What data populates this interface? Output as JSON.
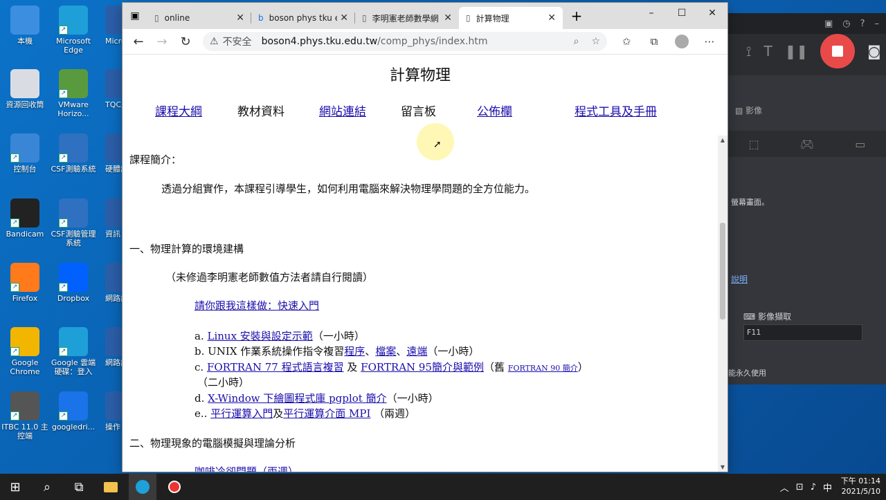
{
  "desktop": {
    "icons": [
      {
        "label": "本機",
        "color": "#3c8fe0"
      },
      {
        "label": "Microsoft Edge",
        "color": "#1e9fd8"
      },
      {
        "label": "資源回收筒",
        "color": "#d9dde3"
      },
      {
        "label": "VMware Horizo...",
        "color": "#5a9a3e"
      },
      {
        "label": "控制台",
        "color": "#3a86d6"
      },
      {
        "label": "CSF測驗系統",
        "color": "#3070c0"
      },
      {
        "label": "Bandicam",
        "color": "#222"
      },
      {
        "label": "CSF測驗管理系統",
        "color": "#3070c0"
      },
      {
        "label": "Firefox",
        "color": "#ff7a1a"
      },
      {
        "label": "Dropbox",
        "color": "#0061fe"
      },
      {
        "label": "Google Chrome",
        "color": "#f2b500"
      },
      {
        "label": "Google 雲端硬碟：登入",
        "color": "#1e9fd8"
      },
      {
        "label": "ITBC 11.0 主控端",
        "color": "#555"
      },
      {
        "label": "googledri...",
        "color": "#1a73e8"
      }
    ],
    "partial_icons": [
      "Micro Tea",
      "TQC題 習系統",
      "硬體說 軟體說",
      "資訊",
      "網路說 統說明",
      "網路說 入說",
      "操作"
    ]
  },
  "bandicam": {
    "menu_items": [
      "影像",
      "螢幕畫面。",
      "說明",
      "影像擷取",
      "F11",
      "能永久使用"
    ]
  },
  "browser": {
    "tabs": [
      {
        "title": "online",
        "icon": "page-icon"
      },
      {
        "title": "boson phys tku edu",
        "icon": "bing-icon"
      },
      {
        "title": "李明憲老師數學網",
        "icon": "page-icon"
      },
      {
        "title": "計算物理",
        "icon": "page-icon"
      }
    ],
    "new_tab": "+",
    "window_controls": [
      "–",
      "☐",
      "✕"
    ],
    "address": {
      "security": "不安全",
      "host": "boson4.phys.tku.edu.tw",
      "path": "/comp_phys/index.htm"
    }
  },
  "page": {
    "title": "計算物理",
    "nav": [
      "課程大綱",
      "教材資料",
      "網站連結",
      "留言板",
      "公佈欄",
      "程式工具及手冊"
    ],
    "intro_heading": "課程簡介：",
    "intro_text": "透過分組實作，本課程引導學生，如何利用電腦來解決物理學問題的全方位能力。",
    "section1": "一、物理計算的環境建構",
    "section1_note": "（未修過李明憲老師數值方法者請自行閱讀）",
    "quickstart": "請你跟我這樣做：快速入門",
    "item_a_prefix": "a.",
    "item_a_link": "Linux 安裝與設定示範",
    "item_a_tail": "（一小時）",
    "item_b_prefix": "b.",
    "item_b_text": "UNIX 作業系統操作指令複習",
    "item_b_l1": "程序",
    "item_b_sep1": "、",
    "item_b_l2": "檔案",
    "item_b_sep2": "、",
    "item_b_l3": "遠端",
    "item_b_tail": "（一小時）",
    "item_c_prefix": "c.",
    "item_c_l1": "FORTRAN 77 程式語言複習",
    "item_c_and": "及",
    "item_c_l2": "FORTRAN 95簡介與範例",
    "item_c_old": "（舊",
    "item_c_l3": "FORTRAN 90 簡介",
    "item_c_close": "）",
    "item_c_time": "（二小時）",
    "item_d_prefix": "d.",
    "item_d_link": "X-Window 下繪圖程式庫 pgplot 簡介",
    "item_d_tail": "（一小時）",
    "item_e_prefix": "e..",
    "item_e_l1": "平行運算入門",
    "item_e_and": "及",
    "item_e_l2": "平行運算介面 MPI",
    "item_e_tail": "（兩週）",
    "section2": "二、物理現象的電腦模擬與理論分析",
    "section2_first": "咖啡冷卻問題（兩週）"
  },
  "taskbar": {
    "time": "下午 01:14",
    "date": "2021/5/10"
  }
}
